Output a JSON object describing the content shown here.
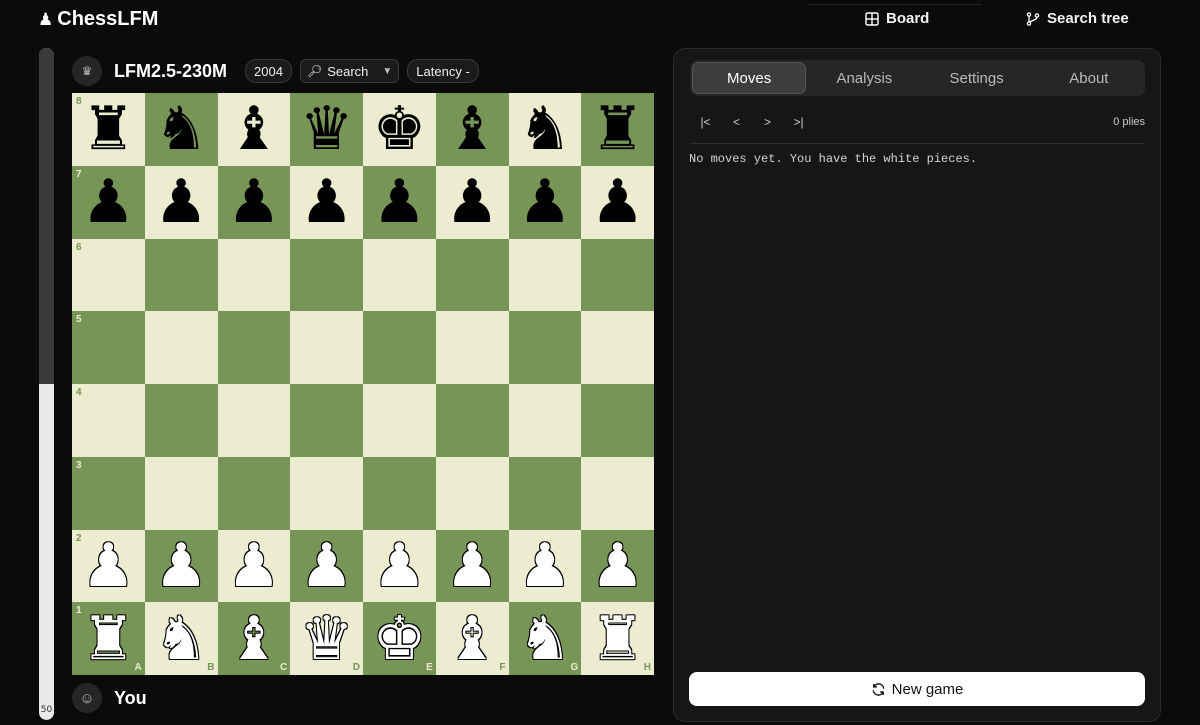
{
  "app": {
    "logo_icon": "♟",
    "name": "ChessLFM"
  },
  "topnav": {
    "board_label": "Board",
    "search_tree_label": "Search tree"
  },
  "eval": {
    "value": "50",
    "white_fraction": 0.5
  },
  "opponent": {
    "avatar_icon": "♛",
    "name": "LFM2.5-230M",
    "rating": "2004",
    "search_label": "Search",
    "latency_label": "Latency -"
  },
  "player": {
    "avatar_icon": "☺",
    "name": "You"
  },
  "board": {
    "colors": {
      "light": "#ebecd0",
      "dark": "#779556"
    },
    "rank_labels": [
      "8",
      "7",
      "6",
      "5",
      "4",
      "3",
      "2",
      "1"
    ],
    "file_labels": [
      "A",
      "B",
      "C",
      "D",
      "E",
      "F",
      "G",
      "H"
    ],
    "rows": [
      [
        "br",
        "bn",
        "bb",
        "bq",
        "bk",
        "bb",
        "bn",
        "br"
      ],
      [
        "bp",
        "bp",
        "bp",
        "bp",
        "bp",
        "bp",
        "bp",
        "bp"
      ],
      [
        "",
        "",
        "",
        "",
        "",
        "",
        "",
        ""
      ],
      [
        "",
        "",
        "",
        "",
        "",
        "",
        "",
        ""
      ],
      [
        "",
        "",
        "",
        "",
        "",
        "",
        "",
        ""
      ],
      [
        "",
        "",
        "",
        "",
        "",
        "",
        "",
        ""
      ],
      [
        "wp",
        "wp",
        "wp",
        "wp",
        "wp",
        "wp",
        "wp",
        "wp"
      ],
      [
        "wr",
        "wn",
        "wb",
        "wq",
        "wk",
        "wb",
        "wn",
        "wr"
      ]
    ]
  },
  "panel": {
    "tabs": [
      {
        "label": "Moves",
        "active": true
      },
      {
        "label": "Analysis",
        "active": false
      },
      {
        "label": "Settings",
        "active": false
      },
      {
        "label": "About",
        "active": false
      }
    ],
    "nav": {
      "first": "|<",
      "prev": "<",
      "next": ">",
      "last": ">|"
    },
    "plies": "0 plies",
    "message": "No moves yet. You have the white pieces.",
    "new_game_label": "New game"
  }
}
